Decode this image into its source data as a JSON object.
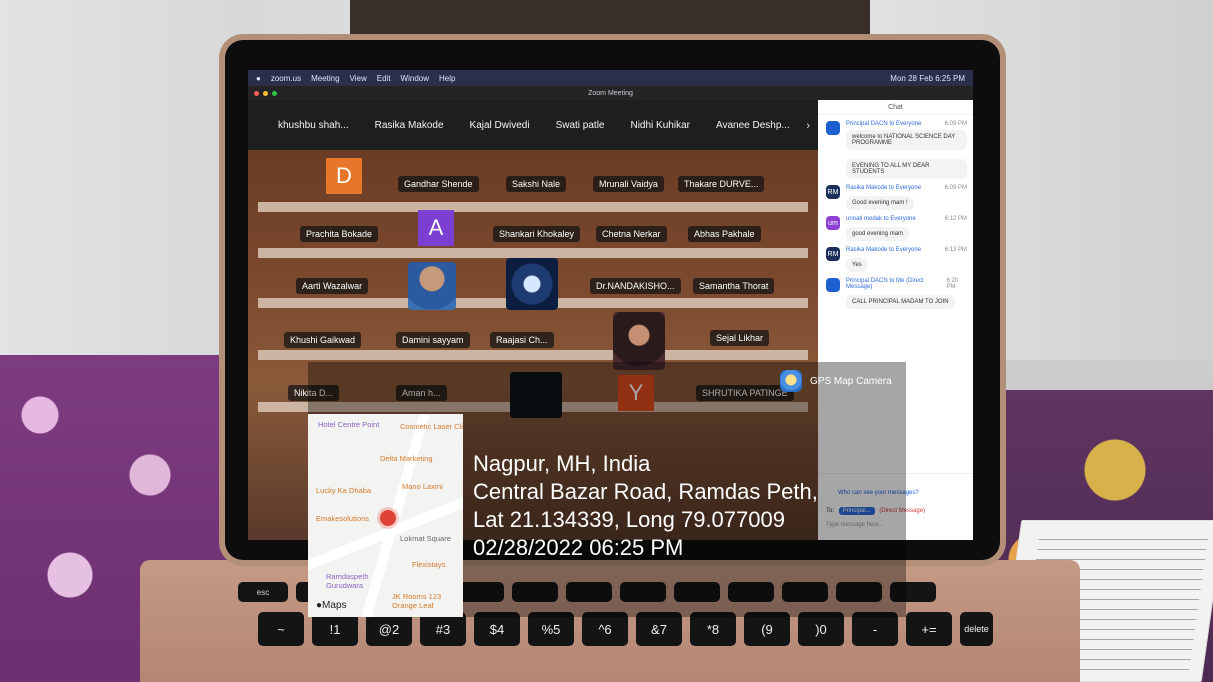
{
  "zoom": {
    "menubar": {
      "app": "zoom.us",
      "items": [
        "Meeting",
        "View",
        "Edit",
        "Window",
        "Help"
      ],
      "status": "Mon 28 Feb 6:25 PM"
    },
    "window_title": "Zoom Meeting",
    "top_strip_names": [
      "khushbu shah...",
      "Rasika Makode",
      "Kajal Dwivedi",
      "Swati patle",
      "Nidhi Kuhikar",
      "Avanee Deshp..."
    ],
    "tiles": {
      "row1": [
        "Gandhar Shende",
        "Sakshi Nale",
        "Mrunali Vaidya",
        "Thakare DURVE..."
      ],
      "row2": [
        "Prachita Bokade",
        "Shankari Khokaley",
        "Chetna Nerkar",
        "Abhas Pakhale"
      ],
      "row3": [
        "Aarti Wazalwar",
        "Dr.NANDAKISHO...",
        "Samantha Thorat"
      ],
      "row4": [
        "Khushi Gaikwad",
        "Damini sayyam",
        "Raajasi Ch...",
        "Sejal Likhar"
      ],
      "row5": [
        "Nikita D...",
        "Aman h...",
        "SHRUTIKA PATINGE"
      ],
      "avatars": {
        "d": "D",
        "a": "A",
        "y": "Y"
      }
    },
    "chat": {
      "title": "Chat",
      "messages": [
        {
          "from": "Principal DACN to Everyone",
          "time": "6:09 PM",
          "avatar": "",
          "text": "welcome to NATIONAL SCIENCE DAY PROGRAMME"
        },
        {
          "from": "",
          "time": "",
          "avatar": "",
          "text": "EVENING TO ALL MY DEAR STUDENTS"
        },
        {
          "from": "Rasika Makode to Everyone",
          "time": "6:09 PM",
          "avatar": "RM",
          "text": "Good evening mam !"
        },
        {
          "from": "unnati modak to Everyone",
          "time": "6:12 PM",
          "avatar": "um",
          "text": "good evening mam"
        },
        {
          "from": "Rasika Makode to Everyone",
          "time": "6:13 PM",
          "avatar": "RM",
          "text": "Yes"
        },
        {
          "from": "Principal DACN to Me (Direct Message)",
          "time": "6:20 PM",
          "avatar": "",
          "text": "CALL PRINCIPAL MADAM TO JOIN"
        }
      ],
      "footer": {
        "who_can_see": "Who can see your messages?",
        "to_label": "To:",
        "to_value": "Principal...",
        "direct": "(Direct Message)",
        "placeholder": "Type message here..."
      }
    }
  },
  "gps_overlay": {
    "app_name": "GPS Map Camera",
    "location_lines": [
      "Nagpur, MH, India",
      "Central Bazar Road, Ramdas Peth,",
      "Lat 21.134339, Long 79.077009",
      "02/28/2022 06:25 PM"
    ],
    "map_labels": [
      "Hotel Centre Point",
      "Cosmetic Laser Clinic",
      "Delta Marketing",
      "Lucky Ka Dhaba",
      "Mano Laxmi",
      "Emakesolutions",
      "Lokmat Square",
      "Flexistays",
      "Ramdaspeth Gurudwara",
      "JK Rooms 123 Orange Leaf"
    ],
    "maps_brand": "Maps"
  },
  "keyboard": {
    "esc": "esc",
    "delete": "delete",
    "row_numbers": [
      "~",
      "!1",
      "@2",
      "#3",
      "$4",
      "%5",
      "^6",
      "&7",
      "*8",
      "(9",
      ")0",
      "-",
      "+="
    ]
  }
}
